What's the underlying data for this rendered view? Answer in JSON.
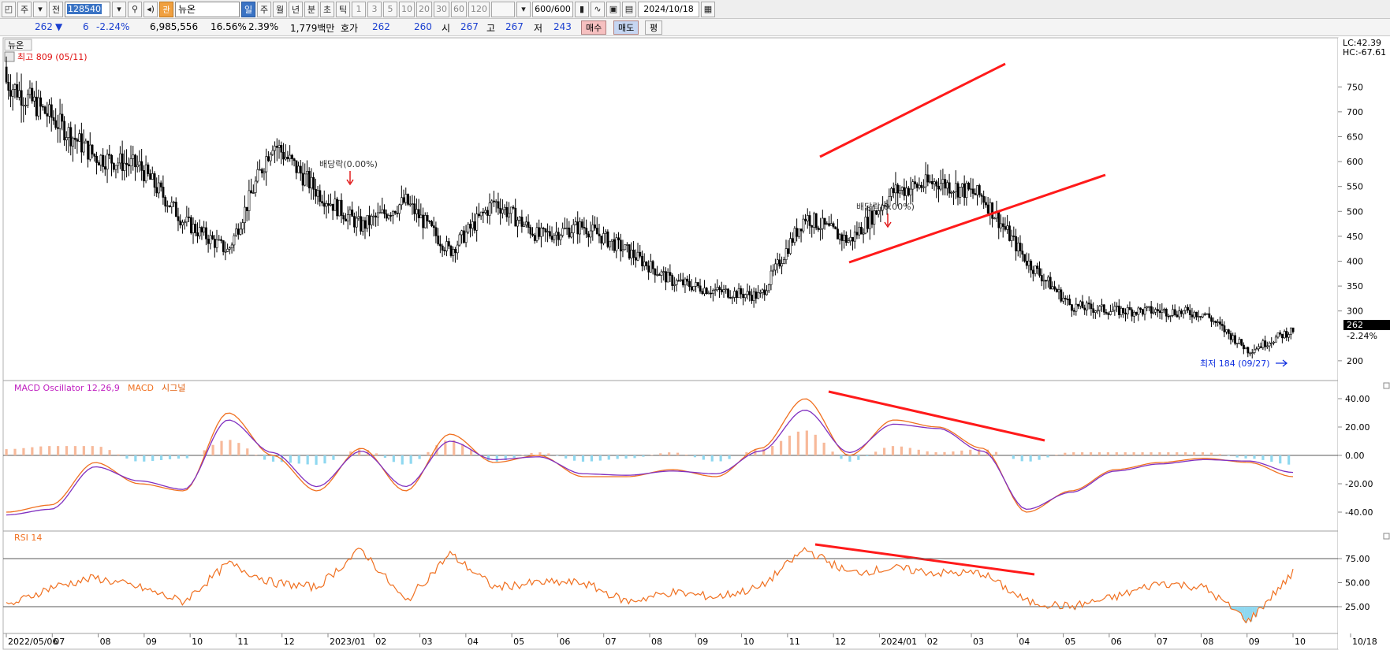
{
  "toolbar": {
    "period_day": "주",
    "view_mode": "전",
    "code": "128540",
    "name": "뉴온",
    "periods": [
      "일",
      "주",
      "월",
      "년",
      "분",
      "초",
      "틱"
    ],
    "intervals": [
      "1",
      "3",
      "5",
      "10",
      "20",
      "30",
      "60",
      "120"
    ],
    "count": "600/600",
    "date": "2024/10/18"
  },
  "quote": {
    "price": "262",
    "change": "6",
    "change_pct": "-2.24%",
    "volume": "6,985,556",
    "turnover_rate": "16.56%",
    "ratio2": "2.39%",
    "amount": "1,779백만",
    "hoga_label": "호가",
    "ask": "262",
    "bid": "260",
    "open_label": "시",
    "open": "267",
    "high_label": "고",
    "high": "267",
    "low_label": "저",
    "low": "243",
    "buy_button": "매수",
    "sell_button": "매도",
    "flat_button": "평"
  },
  "chart": {
    "stock_label": "뉴온",
    "price_panel": {
      "lc_label": "LC:42.39",
      "hc_label": "HC:-67.61",
      "high_annotation": "최고 809 (05/11)",
      "low_annotation": "최저 184 (09/27)",
      "dividend_labels": [
        "배당락(0.00%)",
        "배당락(0.00%)"
      ],
      "current_price_tag": "262",
      "current_change_tag": "-2.24%",
      "y_ticks": [
        "750",
        "700",
        "650",
        "600",
        "550",
        "500",
        "450",
        "400",
        "350",
        "300",
        "200"
      ]
    },
    "macd_panel": {
      "label_osc": "MACD Oscillator 12,26,9",
      "label_macd": "MACD",
      "label_signal": "시그널",
      "y_ticks": [
        "40.00",
        "20.00",
        "0.00",
        "-20.00",
        "-40.00"
      ]
    },
    "rsi_panel": {
      "label": "RSI 14",
      "y_ticks": [
        "75.00",
        "50.00",
        "25.00"
      ]
    },
    "x_labels": [
      "2022/05/06",
      "07",
      "08",
      "09",
      "10",
      "11",
      "12",
      "2023/01",
      "02",
      "03",
      "04",
      "05",
      "06",
      "07",
      "08",
      "09",
      "10",
      "11",
      "12",
      "2024/01",
      "02",
      "03",
      "04",
      "05",
      "06",
      "07",
      "08",
      "09",
      "10",
      "10/18"
    ]
  },
  "colors": {
    "candle": "#000000",
    "trendline": "#ff1a1a",
    "macd_osc_pos": "#f7b99a",
    "macd_osc_neg": "#8fd8f0",
    "macd_line": "#f07020",
    "signal_line": "#8030c0",
    "rsi_line": "#f07020",
    "rsi_fill": "#8fd8f0",
    "high_text": "#e01010",
    "low_text": "#1030e0"
  },
  "chart_data": [
    {
      "type": "candlestick",
      "title": "뉴온",
      "x": [
        "2022/05",
        "2022/06",
        "2022/07",
        "2022/08",
        "2022/09",
        "2022/10",
        "2022/11",
        "2022/12",
        "2023/01",
        "2023/02",
        "2023/03",
        "2023/04",
        "2023/05",
        "2023/06",
        "2023/07",
        "2023/08",
        "2023/09",
        "2023/10",
        "2023/11",
        "2023/12",
        "2024/01",
        "2024/02",
        "2024/03",
        "2024/04",
        "2024/05",
        "2024/06",
        "2024/07",
        "2024/08",
        "2024/09",
        "2024/10"
      ],
      "values": [
        760,
        690,
        610,
        590,
        480,
        420,
        640,
        540,
        470,
        520,
        420,
        520,
        450,
        470,
        420,
        360,
        340,
        330,
        490,
        440,
        540,
        560,
        530,
        400,
        310,
        300,
        300,
        295,
        220,
        262
      ],
      "ylim": [
        170,
        820
      ]
    },
    {
      "type": "line",
      "title": "MACD Oscillator 12,26,9",
      "series": [
        {
          "name": "MACD",
          "values": [
            -40,
            -35,
            -5,
            -20,
            -25,
            30,
            0,
            -25,
            5,
            -25,
            15,
            -5,
            0,
            -15,
            -15,
            -10,
            -15,
            5,
            40,
            0,
            25,
            20,
            5,
            -40,
            -25,
            -10,
            -5,
            -2,
            -5,
            -15
          ]
        },
        {
          "name": "시그널",
          "values": [
            -42,
            -38,
            -8,
            -18,
            -24,
            25,
            2,
            -22,
            3,
            -22,
            10,
            -3,
            -1,
            -13,
            -14,
            -11,
            -13,
            3,
            32,
            2,
            22,
            19,
            3,
            -38,
            -26,
            -11,
            -6,
            -3,
            -4,
            -12
          ]
        }
      ],
      "ylim": [
        -50,
        45
      ]
    },
    {
      "type": "line",
      "title": "RSI 14",
      "series": [
        {
          "name": "RSI 14",
          "values": [
            25,
            45,
            55,
            45,
            30,
            70,
            50,
            45,
            85,
            30,
            80,
            45,
            50,
            50,
            30,
            40,
            35,
            45,
            85,
            60,
            65,
            60,
            60,
            30,
            25,
            35,
            50,
            45,
            10,
            60
          ]
        }
      ],
      "ylim": [
        0,
        100
      ]
    }
  ]
}
